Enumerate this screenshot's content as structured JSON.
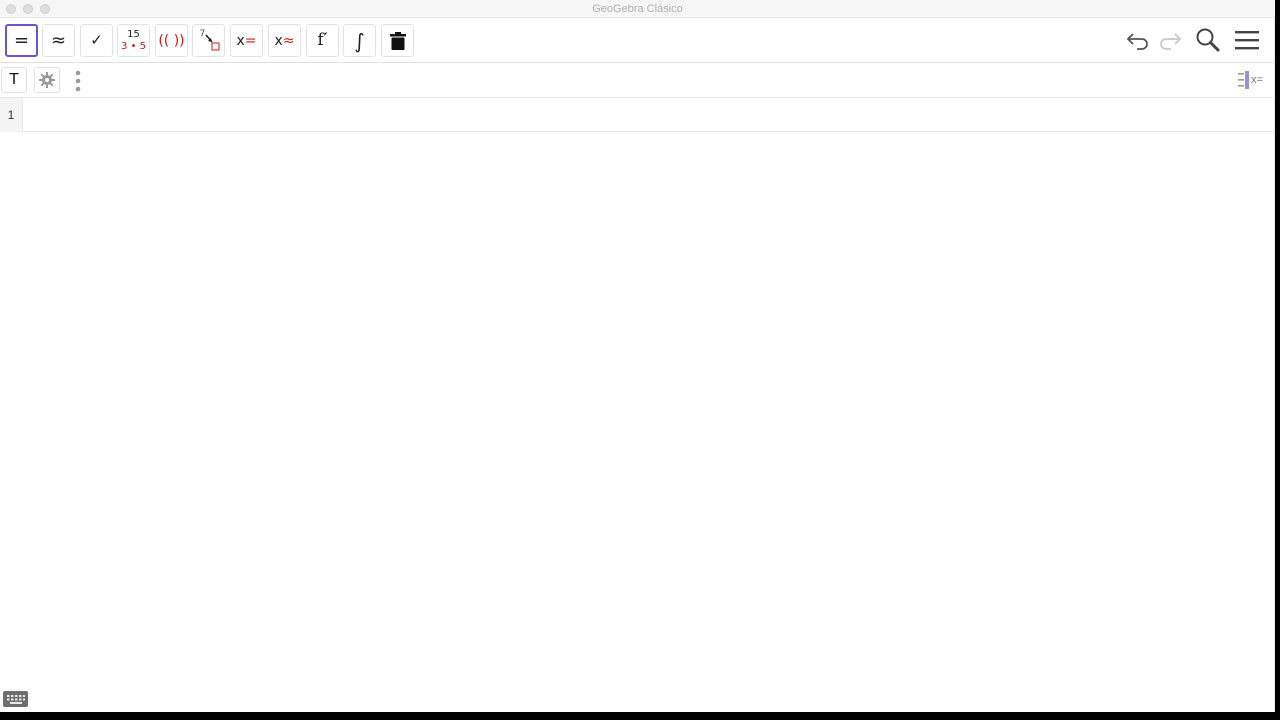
{
  "window": {
    "title": "GeoGebra Clásico"
  },
  "toolbar": {
    "buttons": [
      {
        "name": "evaluate",
        "glyph": "="
      },
      {
        "name": "numeric",
        "glyph": "≈"
      },
      {
        "name": "keep-input",
        "glyph": "✓"
      },
      {
        "name": "factor",
        "numerator": "15",
        "denominator": "3 • 5"
      },
      {
        "name": "expand",
        "glyph": "(( ))"
      },
      {
        "name": "substitute",
        "glyph": "7"
      },
      {
        "name": "solve",
        "x": "x",
        "op": "="
      },
      {
        "name": "solve-numerically",
        "x": "x",
        "op": "≈"
      },
      {
        "name": "derivative",
        "glyph": "f′"
      },
      {
        "name": "integral",
        "glyph": "∫"
      },
      {
        "name": "delete",
        "icon": "trash-icon"
      }
    ],
    "right": {
      "undo_icon": "undo-icon",
      "redo_icon": "redo-icon",
      "search_icon": "search-icon",
      "menu_icon": "menu-icon"
    }
  },
  "stylebar": {
    "text_button": "T",
    "settings_icon": "gear-icon",
    "more_icon": "vertical-dots-icon",
    "view_toggle_icon": "algebra-view-icon",
    "view_toggle_label": "x="
  },
  "cas": {
    "rows": [
      {
        "number": "1",
        "input": ""
      }
    ]
  },
  "colors": {
    "accent": "#6557d2",
    "red": "#d01818",
    "blue": "#3a3aa8"
  },
  "footer": {
    "keyboard_icon": "keyboard-icon"
  }
}
